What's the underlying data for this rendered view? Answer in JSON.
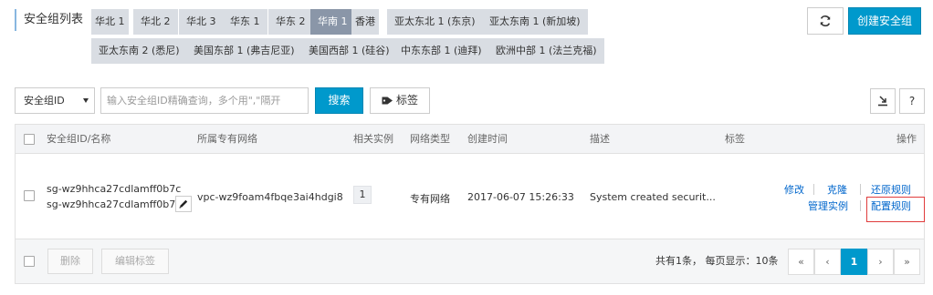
{
  "header": {
    "title": "安全组列表",
    "refresh_icon": "refresh-icon",
    "create_label": "创建安全组"
  },
  "regions": [
    {
      "label": "华北 1",
      "active": false
    },
    {
      "label": "华北 2",
      "active": false
    },
    {
      "label": "华北 3",
      "active": false
    },
    {
      "label": "华东 1",
      "active": false
    },
    {
      "label": "华东 2",
      "active": false
    },
    {
      "label": "华南 1",
      "active": true
    },
    {
      "label": "香港",
      "active": false
    },
    {
      "label": "亚太东北 1 (东京)",
      "active": false
    },
    {
      "label": "亚太东南 1 (新加坡)",
      "active": false
    },
    {
      "label": "亚太东南 2 (悉尼)",
      "active": false
    },
    {
      "label": "美国东部 1 (弗吉尼亚)",
      "active": false
    },
    {
      "label": "美国西部 1 (硅谷)",
      "active": false
    },
    {
      "label": "中东东部 1 (迪拜)",
      "active": false
    },
    {
      "label": "欧洲中部 1 (法兰克福)",
      "active": false
    }
  ],
  "toolbar": {
    "select_value": "安全组ID",
    "search_placeholder": "输入安全组ID精确查询，多个用\",\"隔开",
    "search_label": "搜索",
    "tag_label": "标签",
    "help_label": "?"
  },
  "table": {
    "columns": [
      "安全组ID/名称",
      "所属专有网络",
      "相关实例",
      "网络类型",
      "创建时间",
      "描述",
      "标签",
      "操作"
    ],
    "rows": [
      {
        "id": "sg-wz9hhca27cdlamff0b7c",
        "name": "sg-wz9hhca27cdlamff0b7...",
        "vpc": "vpc-wz9foam4fbqe3ai4hdgi8",
        "instances": "1",
        "network_type": "专有网络",
        "created": "2017-06-07 15:26:33",
        "description": "System created securit...",
        "actions": {
          "modify": "修改",
          "clone": "克隆",
          "restore": "还原规则",
          "manage": "管理实例",
          "configure": "配置规则"
        }
      }
    ]
  },
  "footer": {
    "delete_label": "删除",
    "edit_tags_label": "编辑标签",
    "summary": "共有1条， 每页显示：10条",
    "pages": [
      "«",
      "‹",
      "1",
      "›",
      "»"
    ],
    "current_page": "1"
  }
}
